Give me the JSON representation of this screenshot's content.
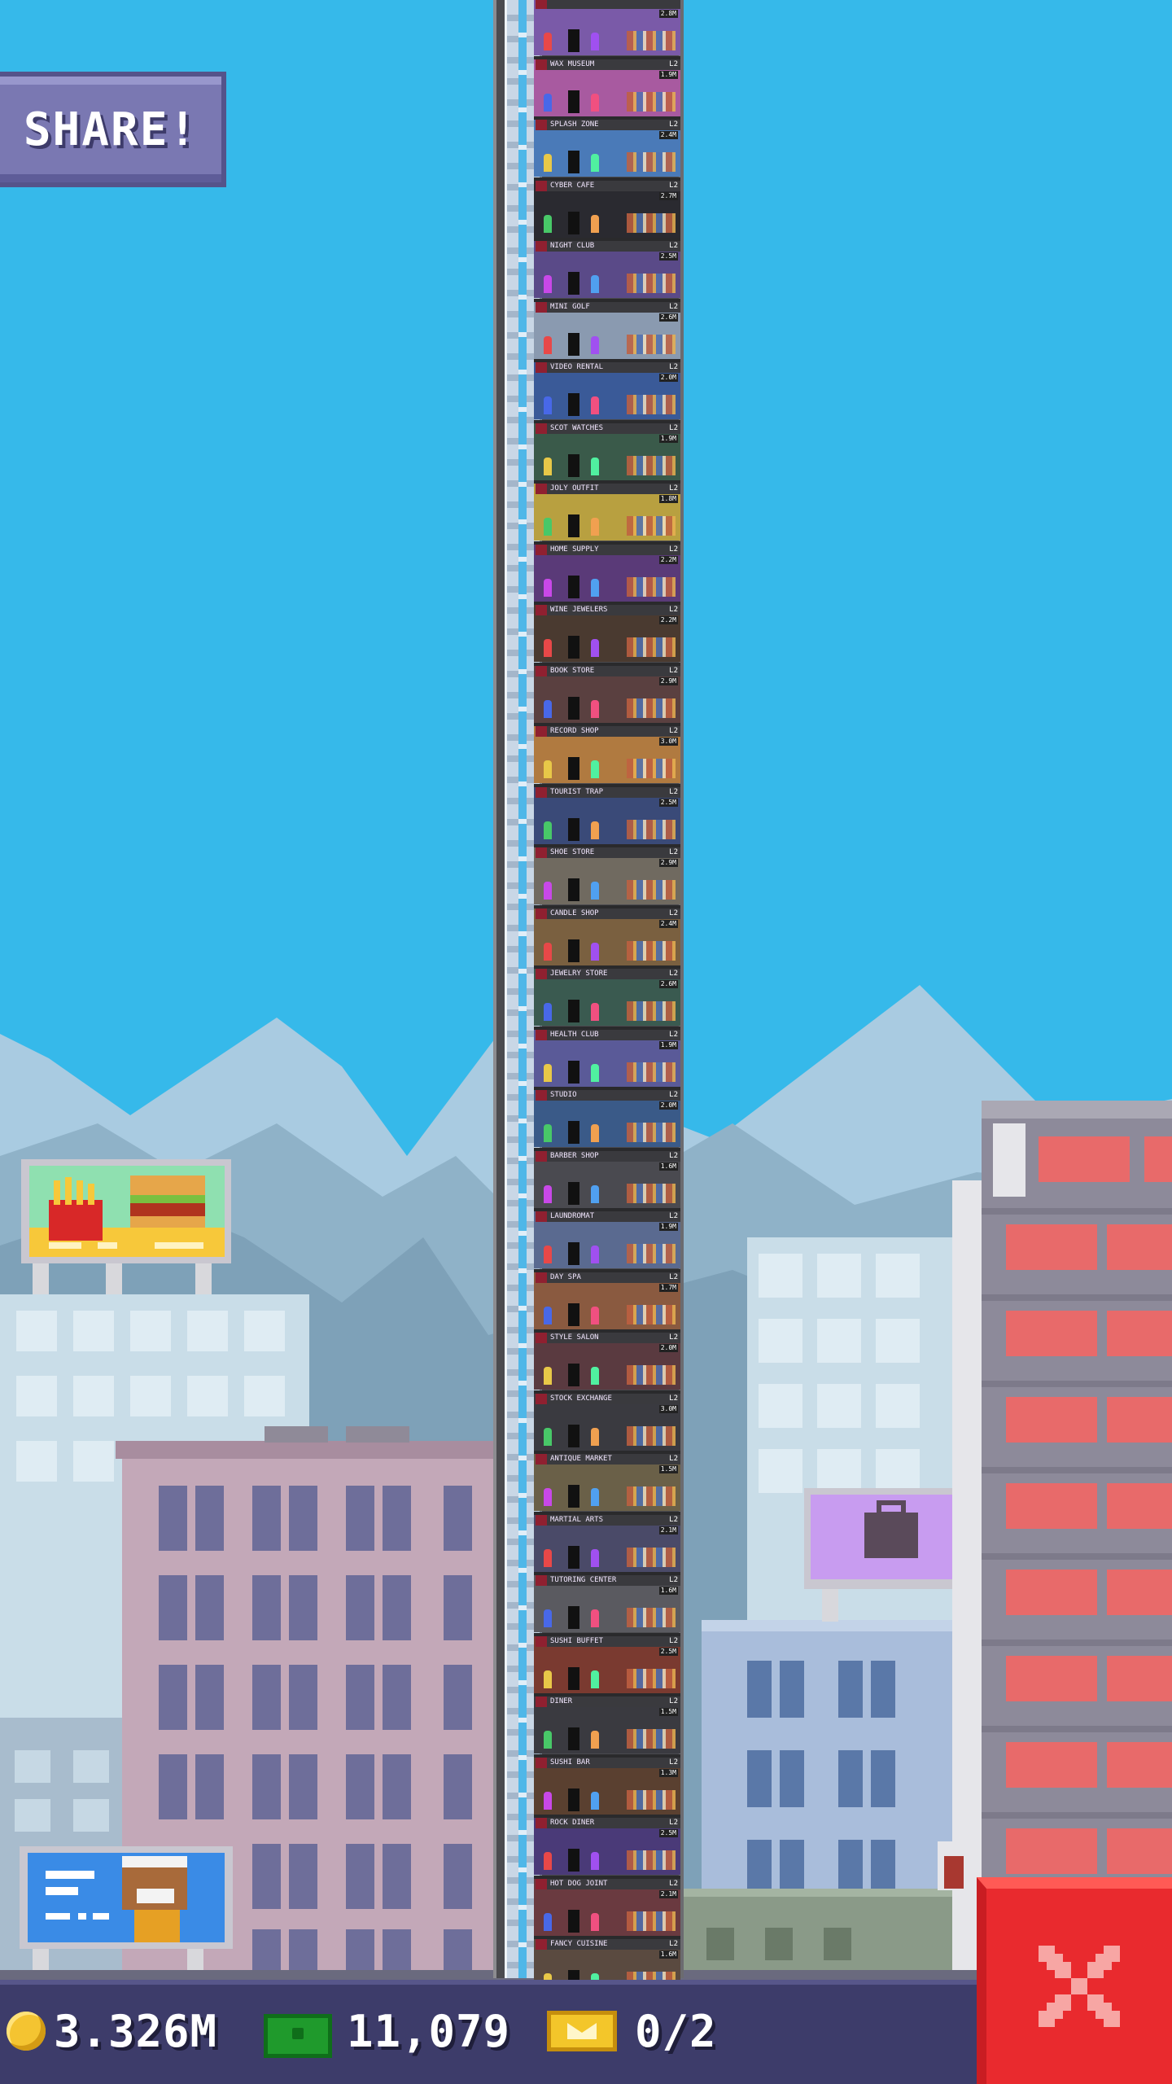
{
  "share": {
    "label": "SHARE!"
  },
  "tower": {
    "floors": [
      {
        "name": "",
        "value": "2.8M",
        "level": "",
        "color": "#7a5aa8"
      },
      {
        "name": "WAX MUSEUM",
        "value": "1.9M",
        "level": "L2",
        "color": "#a85aa0"
      },
      {
        "name": "SPLASH ZONE",
        "value": "2.4M",
        "level": "L2",
        "color": "#4a7ab8"
      },
      {
        "name": "CYBER CAFE",
        "value": "2.7M",
        "level": "L2",
        "color": "#2a2a30"
      },
      {
        "name": "NIGHT CLUB",
        "value": "2.5M",
        "level": "L2",
        "color": "#5a4a88"
      },
      {
        "name": "MINI GOLF",
        "value": "2.6M",
        "level": "L2",
        "color": "#8a9ab0"
      },
      {
        "name": "VIDEO RENTAL",
        "value": "2.0M",
        "level": "L2",
        "color": "#3a5a98"
      },
      {
        "name": "SCOT WATCHES",
        "value": "1.9M",
        "level": "L2",
        "color": "#3a5a4a"
      },
      {
        "name": "JOLY OUTFIT",
        "value": "1.8M",
        "level": "L2",
        "color": "#b8a040"
      },
      {
        "name": "HOME SUPPLY",
        "value": "2.2M",
        "level": "L2",
        "color": "#5a3a78"
      },
      {
        "name": "WINE JEWELERS",
        "value": "2.2M",
        "level": "L2",
        "color": "#4a3a30"
      },
      {
        "name": "BOOK STORE",
        "value": "2.9M",
        "level": "L2",
        "color": "#5a4040"
      },
      {
        "name": "RECORD SHOP",
        "value": "3.0M",
        "level": "L2",
        "color": "#b07a40"
      },
      {
        "name": "TOURIST TRAP",
        "value": "2.5M",
        "level": "L2",
        "color": "#3a4a78"
      },
      {
        "name": "SHOE STORE",
        "value": "2.9M",
        "level": "L2",
        "color": "#706a60"
      },
      {
        "name": "CANDLE SHOP",
        "value": "2.4M",
        "level": "L2",
        "color": "#7a6040"
      },
      {
        "name": "JEWELRY STORE",
        "value": "2.6M",
        "level": "L2",
        "color": "#3a5a50"
      },
      {
        "name": "HEALTH CLUB",
        "value": "1.9M",
        "level": "L2",
        "color": "#5a5a98"
      },
      {
        "name": "STUDIO",
        "value": "2.0M",
        "level": "L2",
        "color": "#3a5a88"
      },
      {
        "name": "BARBER SHOP",
        "value": "1.6M",
        "level": "L2",
        "color": "#4a4a50"
      },
      {
        "name": "LAUNDROMAT",
        "value": "1.9M",
        "level": "L2",
        "color": "#5a6a90"
      },
      {
        "name": "DAY SPA",
        "value": "1.7M",
        "level": "L2",
        "color": "#8a5a40"
      },
      {
        "name": "STYLE SALON",
        "value": "2.0M",
        "level": "L2",
        "color": "#5a3a40"
      },
      {
        "name": "STOCK EXCHANGE",
        "value": "3.0M",
        "level": "L2",
        "color": "#3a3a40"
      },
      {
        "name": "ANTIQUE MARKET",
        "value": "1.5M",
        "level": "L2",
        "color": "#6a6048"
      },
      {
        "name": "MARTIAL ARTS",
        "value": "2.1M",
        "level": "L2",
        "color": "#4a4a68"
      },
      {
        "name": "TUTORING CENTER",
        "value": "1.6M",
        "level": "L2",
        "color": "#5a5a60"
      },
      {
        "name": "SUSHI BUFFET",
        "value": "2.5M",
        "level": "L2",
        "color": "#7a3a30"
      },
      {
        "name": "DINER",
        "value": "1.5M",
        "level": "L2",
        "color": "#3a3a40"
      },
      {
        "name": "SUSHI BAR",
        "value": "1.3M",
        "level": "L2",
        "color": "#5a4030"
      },
      {
        "name": "ROCK DINER",
        "value": "2.5M",
        "level": "L2",
        "color": "#4a3a78"
      },
      {
        "name": "HOT DOG JOINT",
        "value": "2.1M",
        "level": "L2",
        "color": "#6a3a40"
      },
      {
        "name": "FANCY CUISINE",
        "value": "1.6M",
        "level": "L2",
        "color": "#5a4a40"
      }
    ]
  },
  "status": {
    "coins": "3.326M",
    "bux": "11,079",
    "tickets": "0/2"
  },
  "icons": {
    "coin": "coin-icon",
    "bux": "tower-bux-icon",
    "ticket": "golden-ticket-icon",
    "close": "close-icon"
  },
  "colors": {
    "sky": "#36b9ea",
    "bottom_bar": "#3d3c6a",
    "close_button": "#e92a2e",
    "share_button": "#7a78b2"
  }
}
